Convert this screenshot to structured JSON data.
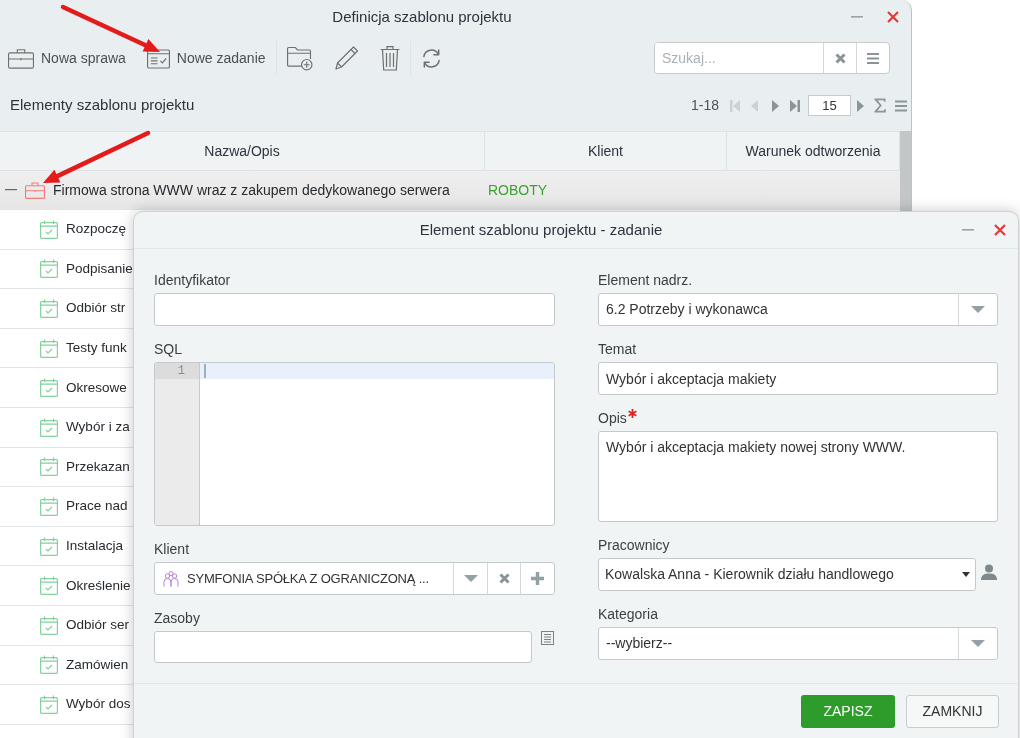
{
  "window": {
    "title": "Definicja szablonu projektu"
  },
  "toolbar": {
    "groups": [
      {
        "buttons": [
          {
            "kind": "new-case",
            "label": "Nowa sprawa"
          },
          {
            "kind": "new-task",
            "label": "Nowe zadanie"
          }
        ]
      },
      {
        "buttons": [
          {
            "kind": "new-folder"
          },
          {
            "kind": "edit"
          },
          {
            "kind": "delete"
          }
        ]
      },
      {
        "buttons": [
          {
            "kind": "refresh"
          }
        ]
      }
    ],
    "search": {
      "placeholder": "Szukaj..."
    }
  },
  "section": {
    "title": "Elementy szablonu projektu"
  },
  "pager": {
    "range": "1-18",
    "nav": [
      {
        "kind": "first",
        "disabled": true
      },
      {
        "kind": "prev",
        "disabled": true
      },
      {
        "kind": "next",
        "disabled": false
      },
      {
        "kind": "last",
        "disabled": false
      }
    ],
    "page_size": "15",
    "actions": [
      {
        "kind": "go"
      },
      {
        "kind": "sum"
      },
      {
        "kind": "menu"
      }
    ]
  },
  "table": {
    "columns": [
      "Nazwa/Opis",
      "Klient",
      "Warunek odtworzenia"
    ],
    "rows": [
      {
        "kind": "case",
        "name": "Firmowa strona WWW wraz z zakupem dedykowanego serwera",
        "client": "ROBOTY",
        "expanded": true,
        "selected": true,
        "children": [
          {
            "kind": "task",
            "name": "Rozpoczę",
            "selected": false
          },
          {
            "kind": "task",
            "name": "Podpisanie",
            "selected": false
          },
          {
            "kind": "task",
            "name": "Odbiór str",
            "selected": false
          },
          {
            "kind": "task",
            "name": "Testy funk",
            "selected": false
          },
          {
            "kind": "task",
            "name": "Okresowe",
            "selected": false
          },
          {
            "kind": "task",
            "name": "Wybór i za",
            "selected": false
          },
          {
            "kind": "task",
            "name": "Przekazan",
            "selected": false
          },
          {
            "kind": "task",
            "name": "Prace nad",
            "selected": false
          },
          {
            "kind": "task",
            "name": "Instalacja",
            "selected": false
          },
          {
            "kind": "task",
            "name": "Określenie",
            "selected": false
          },
          {
            "kind": "task",
            "name": "Odbiór ser",
            "selected": false
          },
          {
            "kind": "task",
            "name": "Zamówien",
            "selected": false
          },
          {
            "kind": "task",
            "name": "Wybór dos",
            "selected": false
          }
        ]
      }
    ]
  },
  "dialog": {
    "title": "Element szablonu projektu - zadanie",
    "form": {
      "left": [
        {
          "kind": "text",
          "label": "Identyfikator",
          "required": false
        },
        {
          "kind": "code",
          "label": "SQL",
          "required": false,
          "lines": [
            {
              "number": "1",
              "active": true
            }
          ]
        },
        {
          "kind": "lookup",
          "label": "Klient",
          "required": false,
          "value": "SYMFONIA SPÓŁKA Z OGRANICZONĄ ..."
        },
        {
          "kind": "list",
          "label": "Zasoby",
          "required": false
        }
      ],
      "right": [
        {
          "kind": "select",
          "label": "Element nadrz.",
          "required": false,
          "value": "6.2 Potrzeby i wykonawca"
        },
        {
          "kind": "text",
          "label": "Temat",
          "required": false,
          "value": "Wybór i akceptacja makiety"
        },
        {
          "kind": "textarea",
          "label": "Opis",
          "required": true,
          "value": "Wybór i akceptacja makiety nowej strony WWW."
        },
        {
          "kind": "employee",
          "label": "Pracownicy",
          "required": false,
          "value": "Kowalska Anna - Kierownik działu handlowego"
        },
        {
          "kind": "select",
          "label": "Kategoria",
          "required": false,
          "value": "--wybierz--"
        }
      ]
    },
    "buttons": [
      {
        "kind": "primary",
        "label": "ZAPISZ"
      },
      {
        "kind": "secondary",
        "label": "ZAMKNIJ"
      }
    ]
  }
}
